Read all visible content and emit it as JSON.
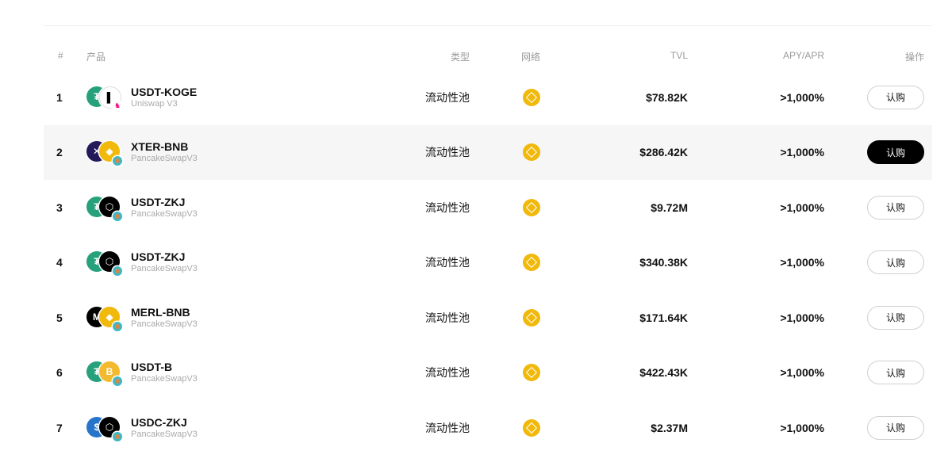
{
  "headers": {
    "num": "#",
    "product": "产品",
    "type": "类型",
    "network": "网络",
    "tvl": "TVL",
    "apy": "APY/APR",
    "action": "操作"
  },
  "rows": [
    {
      "num": "1",
      "name": "USDT-KOGE",
      "dex": "Uniswap V3",
      "type": "流动性池",
      "tvl": "$78.82K",
      "apy": ">1,000%",
      "action": "认购"
    },
    {
      "num": "2",
      "name": "XTER-BNB",
      "dex": "PancakeSwapV3",
      "type": "流动性池",
      "tvl": "$286.42K",
      "apy": ">1,000%",
      "action": "认购"
    },
    {
      "num": "3",
      "name": "USDT-ZKJ",
      "dex": "PancakeSwapV3",
      "type": "流动性池",
      "tvl": "$9.72M",
      "apy": ">1,000%",
      "action": "认购"
    },
    {
      "num": "4",
      "name": "USDT-ZKJ",
      "dex": "PancakeSwapV3",
      "type": "流动性池",
      "tvl": "$340.38K",
      "apy": ">1,000%",
      "action": "认购"
    },
    {
      "num": "5",
      "name": "MERL-BNB",
      "dex": "PancakeSwapV3",
      "type": "流动性池",
      "tvl": "$171.64K",
      "apy": ">1,000%",
      "action": "认购"
    },
    {
      "num": "6",
      "name": "USDT-B",
      "dex": "PancakeSwapV3",
      "type": "流动性池",
      "tvl": "$422.43K",
      "apy": ">1,000%",
      "action": "认购"
    },
    {
      "num": "7",
      "name": "USDC-ZKJ",
      "dex": "PancakeSwapV3",
      "type": "流动性池",
      "tvl": "$2.37M",
      "apy": ">1,000%",
      "action": "认购"
    }
  ],
  "icons": {
    "network": "bnb-chain-icon",
    "tokens": [
      "usdt-icon",
      "koge-icon",
      "xter-icon",
      "bnb-icon",
      "zkj-icon",
      "merl-icon",
      "b-token-icon",
      "usdc-icon"
    ],
    "dex_badges": [
      "uniswap-icon",
      "pancakeswap-icon"
    ]
  },
  "colors": {
    "highlight_row": "#f6f6f6",
    "active_button": "#000000",
    "bnb": "#f0b90b",
    "usdt": "#26a17b",
    "usdc": "#2775ca"
  }
}
